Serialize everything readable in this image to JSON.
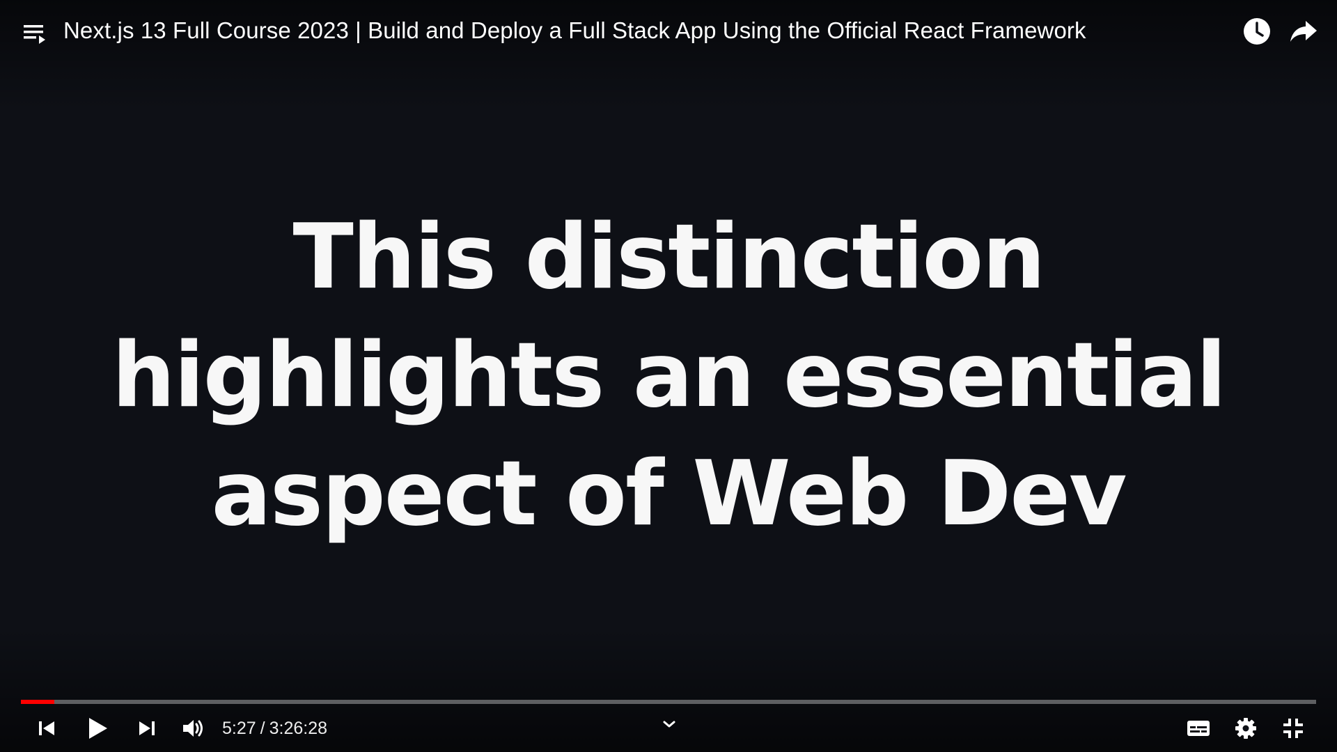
{
  "player": {
    "title": "Next.js 13 Full Course 2023 | Build and Deploy a Full Stack App Using the Official React Framework",
    "slide_lines": [
      "This distinction",
      "highlights an essential",
      "aspect of Web Dev"
    ],
    "current_time": "5:27",
    "separator": "/",
    "duration": "3:26:28",
    "progress_fraction": 0.026
  },
  "colors": {
    "background": "#0e1016",
    "progress_played": "#ff0000",
    "text": "#ffffff"
  },
  "icons": {
    "top_left": "playlist-icon",
    "top_right": [
      "watch-later-icon",
      "share-icon"
    ],
    "controls_left": [
      "previous-icon",
      "play-icon",
      "next-icon",
      "volume-icon"
    ],
    "controls_center": "chevron-down-icon",
    "controls_right": [
      "subtitles-icon",
      "settings-icon",
      "exit-fullscreen-icon"
    ]
  }
}
